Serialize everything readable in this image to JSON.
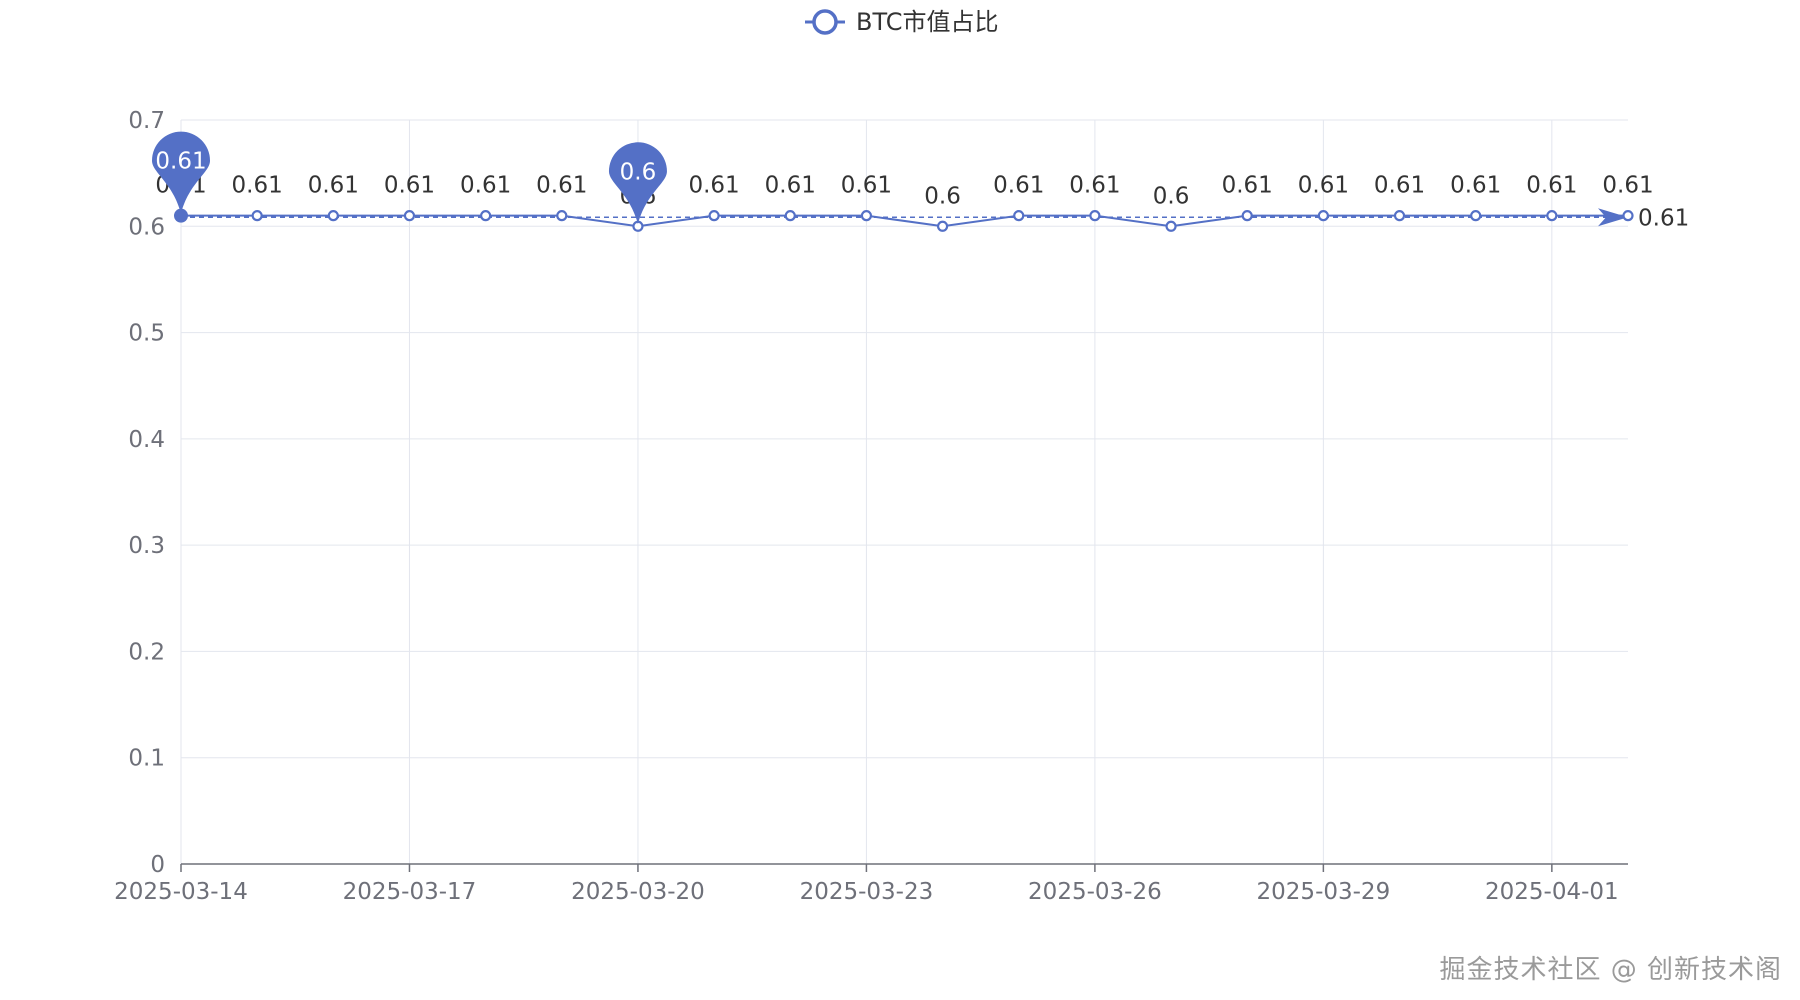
{
  "chart_data": {
    "type": "line",
    "title": "",
    "xlabel": "",
    "ylabel": "",
    "legend": {
      "position": "top-center"
    },
    "x_tick_labels": [
      "2025-03-14",
      "2025-03-17",
      "2025-03-20",
      "2025-03-23",
      "2025-03-26",
      "2025-03-29",
      "2025-04-01"
    ],
    "y_tick_labels": [
      "0",
      "0.1",
      "0.2",
      "0.3",
      "0.4",
      "0.5",
      "0.6",
      "0.7"
    ],
    "ylim": [
      0,
      0.7
    ],
    "grid": true,
    "x": [
      "2025-03-14",
      "2025-03-15",
      "2025-03-16",
      "2025-03-17",
      "2025-03-18",
      "2025-03-19",
      "2025-03-20",
      "2025-03-21",
      "2025-03-22",
      "2025-03-23",
      "2025-03-24",
      "2025-03-25",
      "2025-03-26",
      "2025-03-27",
      "2025-03-28",
      "2025-03-29",
      "2025-03-30",
      "2025-03-31",
      "2025-04-01",
      "2025-04-02"
    ],
    "series": [
      {
        "name": "BTC市值占比",
        "color": "#5470c6",
        "values": [
          0.61,
          0.61,
          0.61,
          0.61,
          0.61,
          0.61,
          0.6,
          0.61,
          0.61,
          0.61,
          0.6,
          0.61,
          0.61,
          0.6,
          0.61,
          0.61,
          0.61,
          0.61,
          0.61,
          0.61
        ],
        "data_labels": [
          "0.61",
          "0.61",
          "0.61",
          "0.61",
          "0.61",
          "0.61",
          "0.6",
          "0.61",
          "0.61",
          "0.61",
          "0.6",
          "0.61",
          "0.61",
          "0.6",
          "0.61",
          "0.61",
          "0.61",
          "0.61",
          "0.61",
          "0.61"
        ]
      }
    ],
    "mark_points": [
      {
        "name": "max",
        "x": "2025-03-14",
        "value": 0.61,
        "label": "0.61"
      },
      {
        "name": "min",
        "x": "2025-03-20",
        "value": 0.6,
        "label": "0.6"
      }
    ],
    "mark_line": {
      "type": "average",
      "label": "0.61"
    }
  },
  "watermark": "掘金技术社区 @ 创新技术阁"
}
